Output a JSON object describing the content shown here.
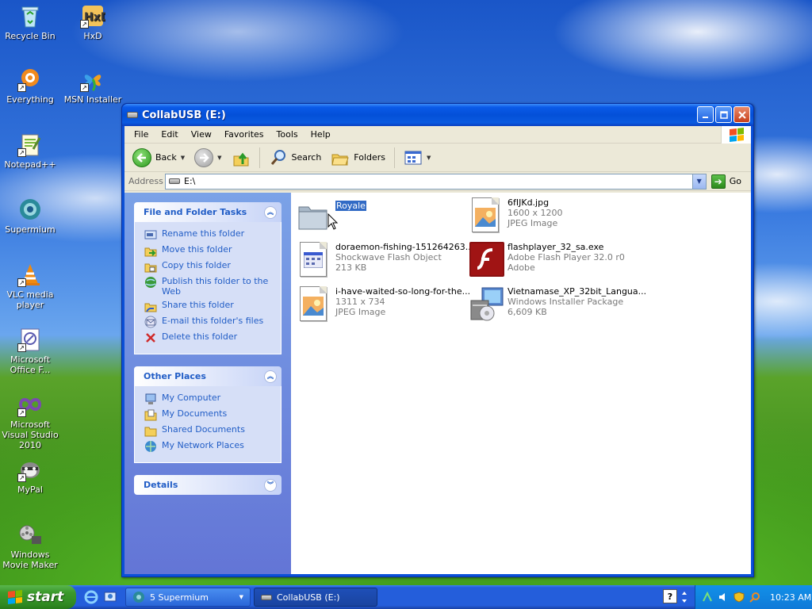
{
  "desktop": {
    "icons": [
      {
        "label": "Recycle Bin"
      },
      {
        "label": "HxD"
      },
      {
        "label": "Everything"
      },
      {
        "label": "MSN Installer"
      },
      {
        "label": "Notepad++"
      },
      {
        "label": "Supermium"
      },
      {
        "label": "VLC media player"
      },
      {
        "label": "Microsoft Office F..."
      },
      {
        "label": "Microsoft Visual Studio 2010"
      },
      {
        "label": "MyPal"
      },
      {
        "label": "Windows Movie Maker"
      }
    ]
  },
  "window": {
    "title": "CollabUSB (E:)",
    "menu": [
      "File",
      "Edit",
      "View",
      "Favorites",
      "Tools",
      "Help"
    ],
    "toolbar": {
      "back": "Back",
      "search": "Search",
      "folders": "Folders"
    },
    "address": {
      "label": "Address",
      "value": "E:\\",
      "go": "Go"
    },
    "taskpane": {
      "file_tasks": {
        "title": "File and Folder Tasks",
        "items": [
          "Rename this folder",
          "Move this folder",
          "Copy this folder",
          "Publish this folder to the Web",
          "Share this folder",
          "E-mail this folder's files",
          "Delete this folder"
        ]
      },
      "other_places": {
        "title": "Other Places",
        "items": [
          "My Computer",
          "My Documents",
          "Shared Documents",
          "My Network Places"
        ]
      },
      "details": {
        "title": "Details"
      }
    },
    "files": [
      {
        "name": "Royale",
        "line2": "",
        "line3": "",
        "selected": true
      },
      {
        "name": "6fIJKd.jpg",
        "line2": "1600 x 1200",
        "line3": "JPEG Image"
      },
      {
        "name": "doraemon-fishing-151264263...",
        "line2": "Shockwave Flash Object",
        "line3": "213 KB"
      },
      {
        "name": "flashplayer_32_sa.exe",
        "line2": "Adobe Flash Player 32.0 r0",
        "line3": "Adobe"
      },
      {
        "name": "i-have-waited-so-long-for-the...",
        "line2": "1311 x 734",
        "line3": "JPEG Image"
      },
      {
        "name": "Vietnamase_XP_32bit_Langua...",
        "line2": "Windows Installer Package",
        "line3": "6,609 KB"
      }
    ]
  },
  "taskbar": {
    "start": "start",
    "tasks": [
      {
        "label": "5 Supermium"
      },
      {
        "label": "CollabUSB (E:)"
      }
    ],
    "clock": "10:23 AM"
  }
}
